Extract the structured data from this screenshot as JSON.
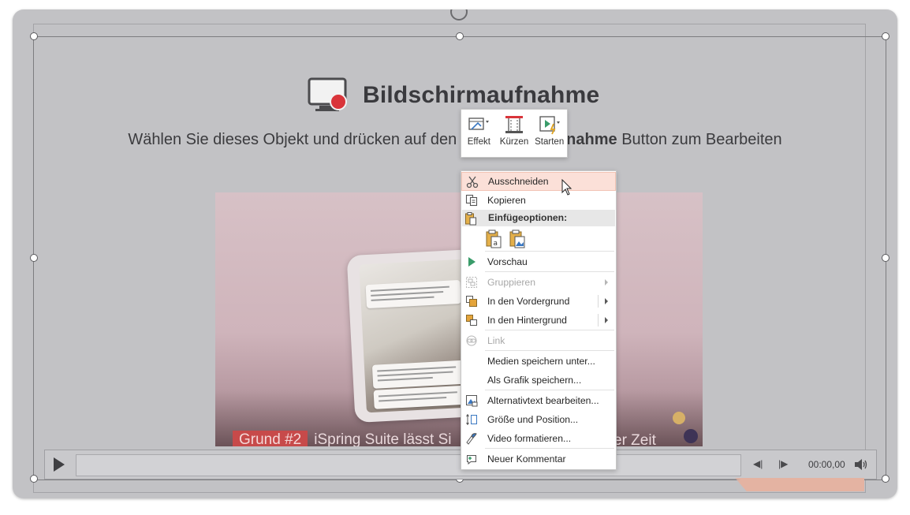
{
  "screen_recording": {
    "title": "Bildschirmaufnahme",
    "instruction_before": "Wählen Sie dieses Objekt und drücken auf den",
    "instruction_bold": "Bildschirmaufnahme",
    "instruction_after": "Button zum Bearbeiten"
  },
  "video": {
    "caption_badge": "Grund #2",
    "caption_text": "iSpring Suite lässt Si",
    "caption_right": "er Zeit"
  },
  "player": {
    "time": "00:00,00"
  },
  "mini_toolbar": {
    "buttons": [
      {
        "label": "Effekt",
        "icon": "effect-icon"
      },
      {
        "label": "Kürzen",
        "icon": "trim-icon"
      },
      {
        "label": "Starten",
        "icon": "start-icon"
      }
    ]
  },
  "context_menu": {
    "cut": "Ausschneiden",
    "copy": "Kopieren",
    "paste_options_header": "Einfügeoptionen:",
    "preview": "Vorschau",
    "group": "Gruppieren",
    "bring_forward": "In den Vordergrund",
    "send_backward": "In den Hintergrund",
    "link": "Link",
    "save_media": "Medien speichern unter...",
    "save_as_picture": "Als Grafik speichern...",
    "alt_text": "Alternativtext bearbeiten...",
    "size_position": "Größe und Position...",
    "format_video": "Video formatieren...",
    "new_comment": "Neuer Kommentar"
  },
  "colors": {
    "menu_hover": "#fbe0d8",
    "slide_background": "#c2c2c5",
    "accent_red": "#c74a4a"
  }
}
